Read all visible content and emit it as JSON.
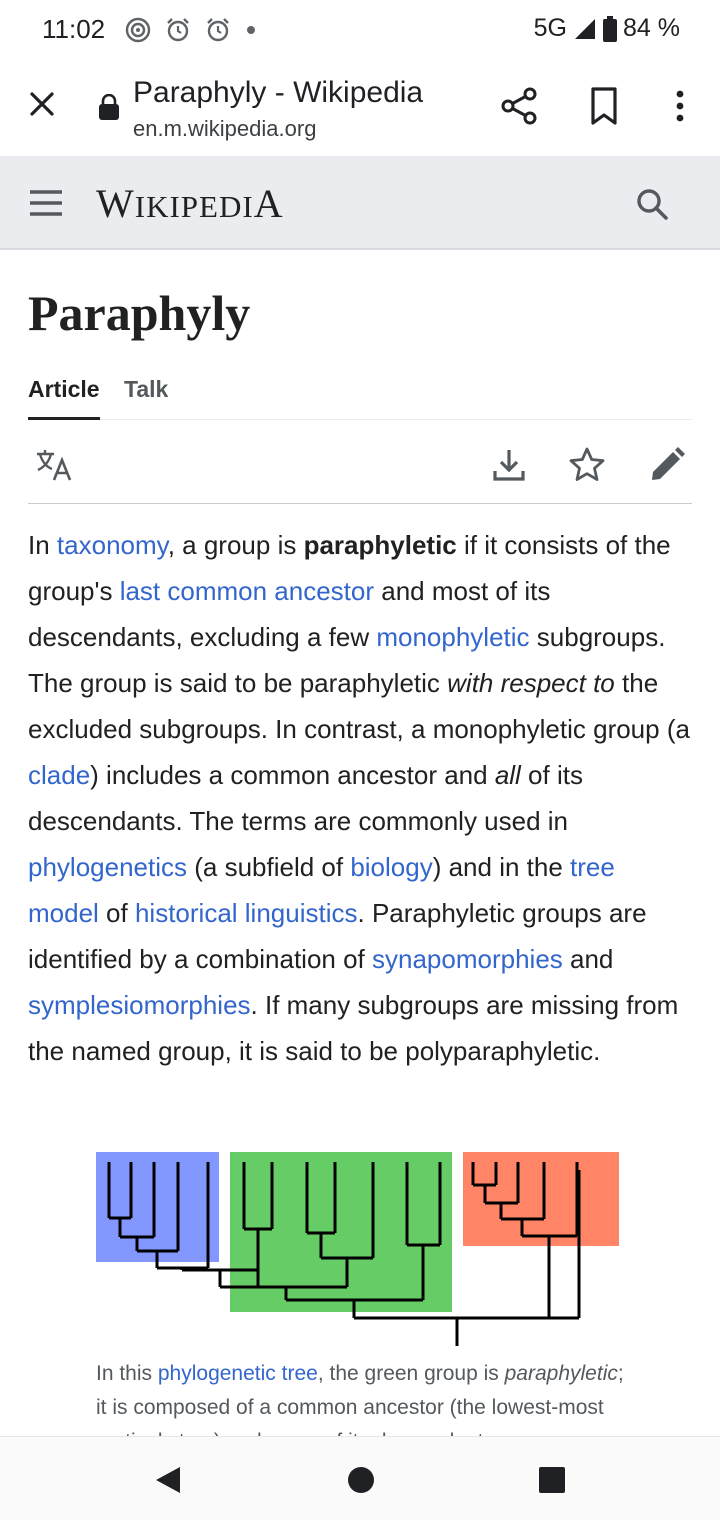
{
  "status_bar": {
    "time": "11:02",
    "network": "5G",
    "battery": "84 %"
  },
  "browser": {
    "page_title": "Paraphyly - Wikipedia",
    "url": "en.m.wikipedia.org",
    "icons": [
      "close-icon",
      "lock-icon",
      "share-icon",
      "bookmark-icon",
      "more-vert-icon"
    ]
  },
  "wiki_header": {
    "logo_first": "W",
    "logo_mid": "IKIPEDI",
    "logo_last": "A",
    "icons": [
      "menu-icon",
      "search-icon"
    ]
  },
  "article": {
    "title": "Paraphyly",
    "tabs": [
      {
        "label": "Article",
        "active": true
      },
      {
        "label": "Talk",
        "active": false
      }
    ],
    "actions": [
      "language-icon",
      "download-icon",
      "watch-star-icon",
      "edit-pencil-icon"
    ],
    "paragraph": {
      "s1": "In ",
      "l_taxonomy": "taxonomy",
      "s2": ", a group is ",
      "b_paraphyletic": "paraphyletic",
      "s3": " if it consists of the group's ",
      "l_lca": "last common ancestor",
      "s4": " and most of its descendants, excluding a few ",
      "l_monophyletic": "monophyletic",
      "s5": " subgroups. The group is said to be paraphyletic ",
      "i_with_respect": "with respect to",
      "s6": " the excluded subgroups. In contrast, a monophyletic group (a ",
      "l_clade": "clade",
      "s7": ") includes a common ancestor and ",
      "i_all": "all",
      "s8": " of its descendants. The terms are commonly used in ",
      "l_phylogenetics": "phylogenetics",
      "s9": " (a subfield of ",
      "l_biology": "biology",
      "s10": ") and in the ",
      "l_tree_model": "tree model",
      "s11": " of ",
      "l_hist_ling": "historical linguistics",
      "s12": ". Paraphyletic groups are identified by a combination of ",
      "l_synapo": "synapomorphies",
      "s13": " and ",
      "l_symplesio": "symplesiomorphies",
      "s14": ". If many subgroups are missing from the named group, it is said to be polyparaphyletic."
    },
    "figure": {
      "colors": {
        "blue": "#8298ff",
        "green": "#66cc66",
        "orange": "#ff8566"
      }
    },
    "caption": {
      "c1": "In this ",
      "l_tree": "phylogenetic tree",
      "c2": ", the green group is ",
      "i_para": "paraphyletic",
      "c3": "; it is composed of a common ancestor (the lowest-most vertical stem) and some of its descendants"
    }
  },
  "nav_bar": {
    "icons": [
      "back-triangle-icon",
      "home-circle-icon",
      "recents-square-icon"
    ]
  }
}
